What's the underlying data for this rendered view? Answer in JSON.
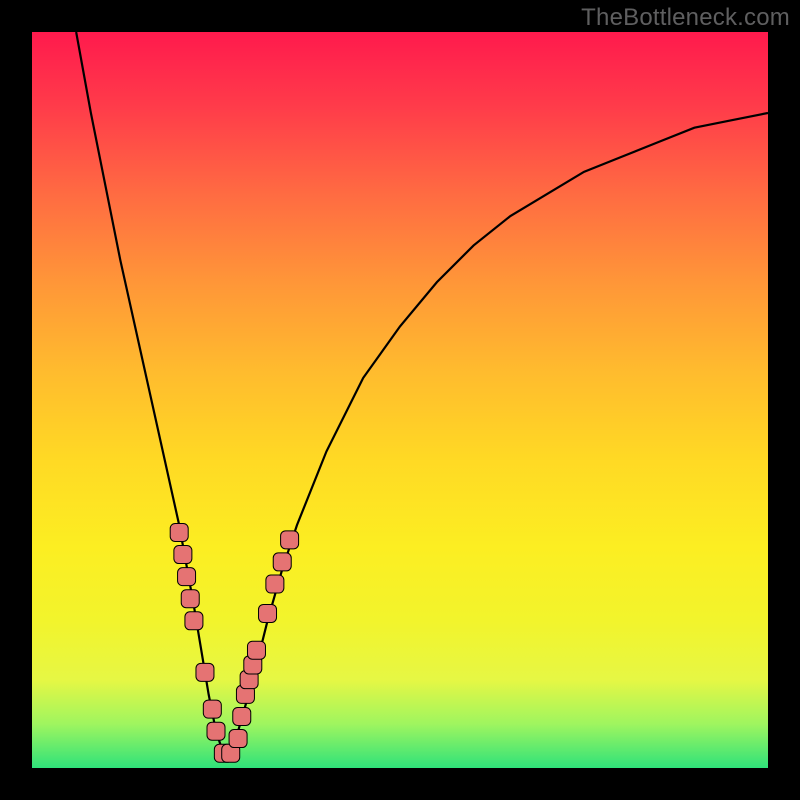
{
  "watermark": {
    "text": "TheBottleneck.com"
  },
  "colors": {
    "curve_stroke": "#000000",
    "marker_fill": "#e57373",
    "marker_stroke": "#000000",
    "frame": "#000000"
  },
  "chart_data": {
    "type": "line",
    "title": "",
    "xlabel": "",
    "ylabel": "",
    "xlim": [
      0,
      100
    ],
    "ylim": [
      0,
      100
    ],
    "grid": false,
    "legend": false,
    "series": [
      {
        "name": "bottleneck-curve",
        "x": [
          6,
          8,
          10,
          12,
          14,
          16,
          18,
          20,
          22,
          23,
          24,
          25,
          26,
          27,
          28,
          30,
          32,
          34,
          36,
          40,
          45,
          50,
          55,
          60,
          65,
          70,
          75,
          80,
          85,
          90,
          95,
          100
        ],
        "y": [
          100,
          89,
          79,
          69,
          60,
          51,
          42,
          33,
          22,
          16,
          10,
          5,
          2,
          2,
          5,
          12,
          20,
          27,
          33,
          43,
          53,
          60,
          66,
          71,
          75,
          78,
          81,
          83,
          85,
          87,
          88,
          89
        ]
      }
    ],
    "markers": [
      {
        "x": 20.0,
        "y": 32
      },
      {
        "x": 20.5,
        "y": 29
      },
      {
        "x": 21.0,
        "y": 26
      },
      {
        "x": 21.5,
        "y": 23
      },
      {
        "x": 22.0,
        "y": 20
      },
      {
        "x": 23.5,
        "y": 13
      },
      {
        "x": 24.5,
        "y": 8
      },
      {
        "x": 25.0,
        "y": 5
      },
      {
        "x": 26.0,
        "y": 2
      },
      {
        "x": 27.0,
        "y": 2
      },
      {
        "x": 28.0,
        "y": 4
      },
      {
        "x": 28.5,
        "y": 7
      },
      {
        "x": 29.0,
        "y": 10
      },
      {
        "x": 29.5,
        "y": 12
      },
      {
        "x": 30.0,
        "y": 14
      },
      {
        "x": 30.5,
        "y": 16
      },
      {
        "x": 32.0,
        "y": 21
      },
      {
        "x": 33.0,
        "y": 25
      },
      {
        "x": 34.0,
        "y": 28
      },
      {
        "x": 35.0,
        "y": 31
      }
    ]
  }
}
